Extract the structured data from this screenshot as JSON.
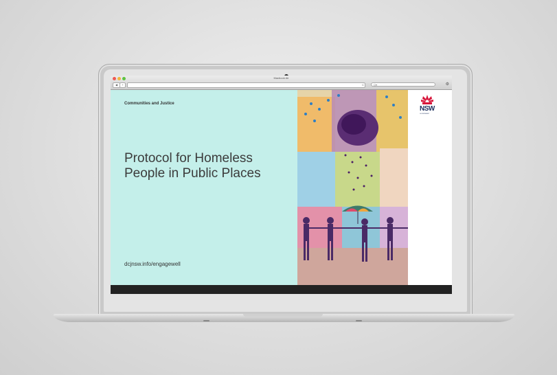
{
  "browser": {
    "window_title": "Macbook Air",
    "back_label": "◀",
    "forward_label": "▶",
    "add_label": "+",
    "reload_label": "C",
    "search_placeholder": "Q▾",
    "gear_label": "⚙"
  },
  "page": {
    "department": "Communities and Justice",
    "title": "Protocol for Homeless People in Public Places",
    "url": "dcjnsw.info/engagewell",
    "logo_text": "NSW",
    "logo_subtext": "GOVERNMENT"
  },
  "colors": {
    "mint": "#c4efea",
    "nsw_red": "#d7153a",
    "nsw_blue": "#1c2e5c"
  },
  "icons": [
    "waratah-flower-icon",
    "gear-icon",
    "reload-icon"
  ]
}
